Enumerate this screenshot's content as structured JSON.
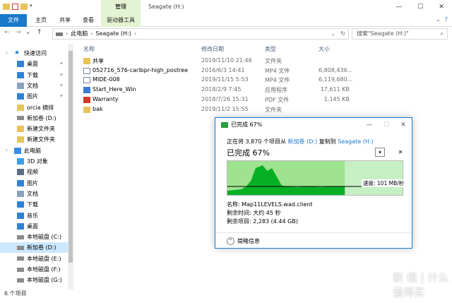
{
  "window": {
    "title": "Seagate (H:)",
    "context_tab": "管理",
    "controls": [
      "—",
      "☐",
      "✕"
    ]
  },
  "ribbon": {
    "tabs": [
      "文件",
      "主页",
      "共享",
      "查看",
      "驱动器工具"
    ],
    "right_icons": [
      "chevron-down-icon",
      "help-icon"
    ]
  },
  "address": {
    "path": [
      "此电脑",
      "Seagate (H:)"
    ],
    "search_placeholder": "搜索\"Seagate (H:)\""
  },
  "nav_pane": {
    "items": [
      {
        "label": "快速访问",
        "icon": "star-icon",
        "color": "#1979ca",
        "level": 0
      },
      {
        "label": "桌面",
        "icon": "desktop-icon",
        "color": "#2f83d6",
        "level": 1,
        "pinned": true
      },
      {
        "label": "下载",
        "icon": "download-icon",
        "color": "#2f83d6",
        "level": 1,
        "pinned": true
      },
      {
        "label": "文档",
        "icon": "document-icon",
        "color": "#8aa2bd",
        "level": 1,
        "pinned": true
      },
      {
        "label": "图片",
        "icon": "picture-icon",
        "color": "#2f83d6",
        "level": 1,
        "pinned": true
      },
      {
        "label": "orcia 摘排",
        "icon": "folder-icon",
        "color": "#e9c35a",
        "level": 1
      },
      {
        "label": "新加卷 (D:)",
        "icon": "drive-icon",
        "color": "#8a8a8a",
        "level": 1
      },
      {
        "label": "新建文件夹",
        "icon": "folder-icon",
        "color": "#e9c35a",
        "level": 1
      },
      {
        "label": "新建文件夹",
        "icon": "folder-icon",
        "color": "#e9c35a",
        "level": 1
      },
      {
        "label": "此电脑",
        "icon": "computer-icon",
        "color": "#3a8ee6",
        "level": 0
      },
      {
        "label": "3D 对象",
        "icon": "cube-icon",
        "color": "#3aa0e6",
        "level": 1
      },
      {
        "label": "视频",
        "icon": "video-icon",
        "color": "#5a6d86",
        "level": 1
      },
      {
        "label": "图片",
        "icon": "picture-icon",
        "color": "#2f83d6",
        "level": 1
      },
      {
        "label": "文档",
        "icon": "document-icon",
        "color": "#8aa2bd",
        "level": 1
      },
      {
        "label": "下载",
        "icon": "download-icon",
        "color": "#2f83d6",
        "level": 1
      },
      {
        "label": "音乐",
        "icon": "music-icon",
        "color": "#2f83d6",
        "level": 1
      },
      {
        "label": "桌面",
        "icon": "desktop-icon",
        "color": "#2f83d6",
        "level": 1
      },
      {
        "label": "本地磁盘 (C:)",
        "icon": "drive-icon",
        "color": "#8a8a8a",
        "level": 1
      },
      {
        "label": "新加卷 (D:)",
        "icon": "drive-icon",
        "color": "#8a8a8a",
        "level": 1,
        "selected": true
      },
      {
        "label": "本地磁盘 (E:)",
        "icon": "drive-icon",
        "color": "#8a8a8a",
        "level": 1
      },
      {
        "label": "本地磁盘 (F:)",
        "icon": "drive-icon",
        "color": "#8a8a8a",
        "level": 1
      },
      {
        "label": "本地磁盘 (G:)",
        "icon": "drive-icon",
        "color": "#8a8a8a",
        "level": 1
      }
    ]
  },
  "file_list": {
    "columns": [
      "名称",
      "修改日期",
      "类型",
      "大小"
    ],
    "rows": [
      {
        "name": "共享",
        "date": "2019/11/10 21:46",
        "type": "文件夹",
        "size": "",
        "icon": "folder"
      },
      {
        "name": "052716_576-caribpr-high_postree",
        "date": "2016/6/3 14:41",
        "type": "MP4 文件",
        "size": "6,808,436...",
        "icon": "doc"
      },
      {
        "name": "MIDE-008",
        "date": "2019/11/15 5:53",
        "type": "MP4 文件",
        "size": "6,119,680...",
        "icon": "doc"
      },
      {
        "name": "Start_Here_Win",
        "date": "2018/2/9 7:45",
        "type": "应用程序",
        "size": "17,611 KB",
        "icon": "exe"
      },
      {
        "name": "Warranty",
        "date": "2018/7/26 15:31",
        "type": "PDF 文件",
        "size": "1,145 KB",
        "icon": "pdf"
      },
      {
        "name": "bak",
        "date": "2019/11/2 15:55",
        "type": "文件夹",
        "size": "",
        "icon": "folder"
      }
    ]
  },
  "status": {
    "count": "6 个项目"
  },
  "copy_dialog": {
    "title": "已完成 67%",
    "prefix": "正在将 3,870 个项目从",
    "source": "新加卷 (D:)",
    "middle": "复制到",
    "dest": "Seagate (H:)",
    "progress_label": "已完成 67%",
    "progress": 0.67,
    "pause": "⏸",
    "cancel": "✕",
    "speed": "速度: 101 MB/秒",
    "name_line": "名称:  Map11LEVELS.wad.client",
    "time_line": "剩余时间:  大约 45 秒",
    "items_line": "剩余项目:  2,283 (4.44 GB)",
    "more": "简略信息",
    "colors": {
      "done": "#06b025",
      "pending": "#c6f0c4",
      "border": "#1979ca"
    }
  },
  "watermark": "新 值 | 什么值得买"
}
